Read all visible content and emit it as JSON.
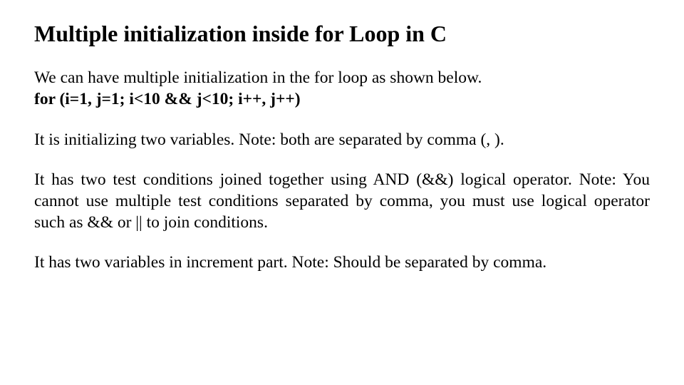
{
  "title": "Multiple initialization inside for Loop in C",
  "intro": "We can have multiple initialization in the for loop as shown below.",
  "code": "for (i=1, j=1; i<10 && j<10; i++, j++)",
  "para1": "It is initializing two variables. Note: both are separated by comma (, ).",
  "para2": "It has two test conditions joined together using AND (&&) logical operator. Note: You cannot use multiple test conditions separated by comma, you must use logical operator such as && or || to join conditions.",
  "para3": "It has two variables in increment part. Note: Should be separated by comma."
}
